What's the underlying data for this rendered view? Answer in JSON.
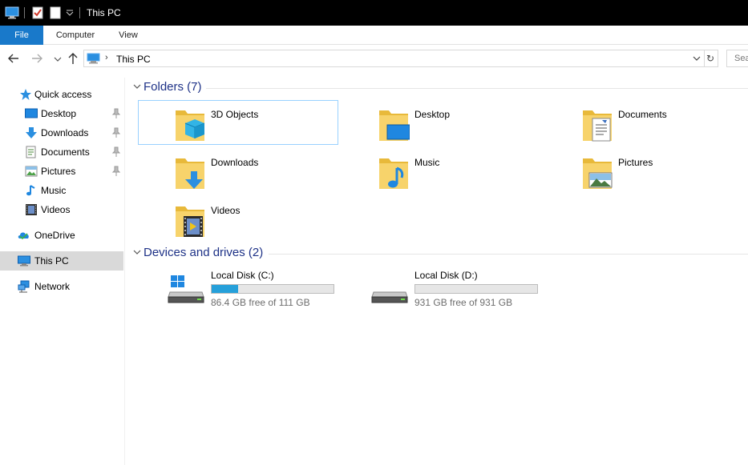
{
  "window": {
    "title": "This PC"
  },
  "ribbon": {
    "tabs": [
      {
        "label": "File"
      },
      {
        "label": "Computer"
      },
      {
        "label": "View"
      }
    ]
  },
  "address": {
    "breadcrumb": "This PC",
    "search_placeholder": "Sea"
  },
  "nav": {
    "quick_access": "Quick access",
    "items": [
      {
        "label": "Desktop",
        "icon": "desktop-icon",
        "pinned": true
      },
      {
        "label": "Downloads",
        "icon": "downloads-icon",
        "pinned": true
      },
      {
        "label": "Documents",
        "icon": "documents-icon",
        "pinned": true
      },
      {
        "label": "Pictures",
        "icon": "pictures-icon",
        "pinned": true
      },
      {
        "label": "Music",
        "icon": "music-icon",
        "pinned": false
      },
      {
        "label": "Videos",
        "icon": "videos-icon",
        "pinned": false
      }
    ],
    "onedrive": "OneDrive",
    "this_pc": "This PC",
    "network": "Network"
  },
  "folders": {
    "header": "Folders (7)",
    "items": [
      {
        "name": "3D Objects",
        "icon": "3d-objects-icon"
      },
      {
        "name": "Desktop",
        "icon": "desktop-folder-icon"
      },
      {
        "name": "Documents",
        "icon": "documents-folder-icon"
      },
      {
        "name": "Downloads",
        "icon": "downloads-folder-icon"
      },
      {
        "name": "Music",
        "icon": "music-folder-icon"
      },
      {
        "name": "Pictures",
        "icon": "pictures-folder-icon"
      },
      {
        "name": "Videos",
        "icon": "videos-folder-icon"
      }
    ]
  },
  "drives": {
    "header": "Devices and drives (2)",
    "items": [
      {
        "name": "Local Disk (C:)",
        "free_text": "86.4 GB free of 111 GB",
        "used_fraction": 0.22,
        "icon": "windows-drive-icon"
      },
      {
        "name": "Local Disk (D:)",
        "free_text": "931 GB free of 931 GB",
        "used_fraction": 0.0,
        "icon": "hard-drive-icon"
      }
    ]
  },
  "colors": {
    "accent": "#1979ca",
    "group_header": "#1e3287",
    "usage_bar": "#26a0da",
    "folder": "#f4c342"
  }
}
